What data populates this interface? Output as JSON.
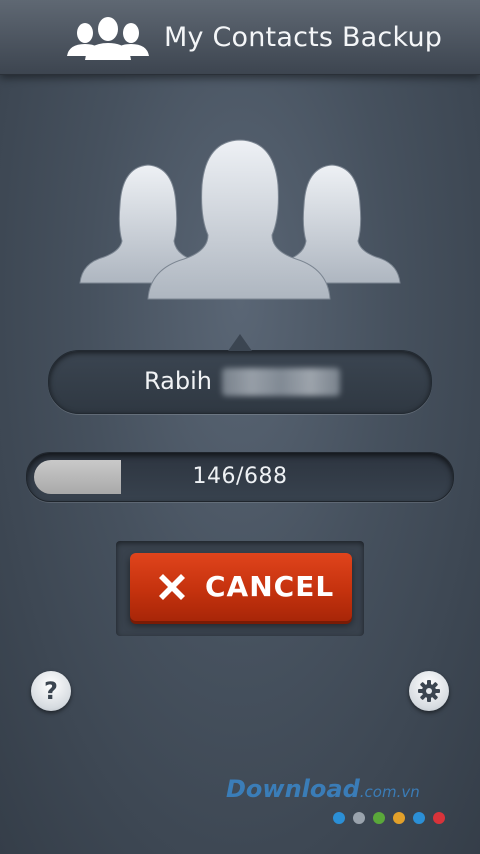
{
  "header": {
    "title": "My Contacts Backup",
    "icon": "contacts-group-icon"
  },
  "contact": {
    "name": "Rabih",
    "surname_hidden": true
  },
  "progress": {
    "current": 146,
    "total": 688,
    "text": "146/688",
    "fraction": 0.212
  },
  "cancel_button": {
    "label": "CANCEL",
    "icon": "close-x-icon",
    "color": "#c5320e"
  },
  "help_button": {
    "label": "?"
  },
  "settings_button": {
    "icon": "gear-icon"
  },
  "watermark": {
    "brand": "Download",
    "suffix": ".com.vn",
    "dot_colors": [
      "#2b8fd6",
      "#9aa3ad",
      "#5aa83a",
      "#e2a02a",
      "#2b8fd6",
      "#d8333a"
    ]
  }
}
